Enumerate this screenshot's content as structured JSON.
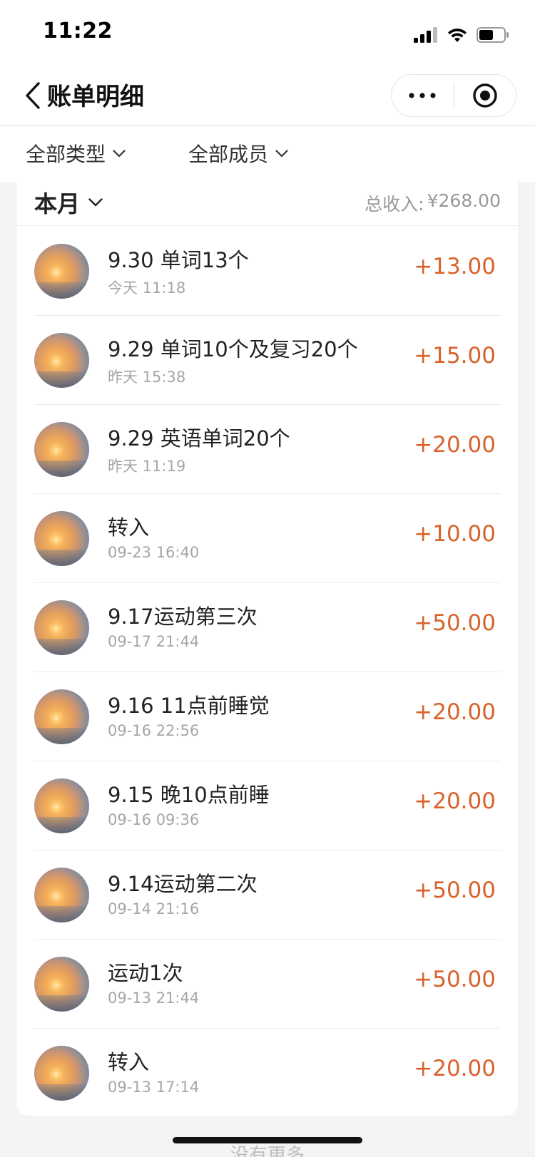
{
  "status_bar": {
    "time": "11:22"
  },
  "nav": {
    "title": "账单明细"
  },
  "filters": {
    "type_label": "全部类型",
    "member_label": "全部成员"
  },
  "summary": {
    "period": "本月",
    "total_label": "总收入:",
    "total_value": "¥268.00"
  },
  "transactions": [
    {
      "title": "9.30 单词13个",
      "time": "今天 11:18",
      "amount": "+13.00"
    },
    {
      "title": "9.29 单词10个及复习20个",
      "time": "昨天 15:38",
      "amount": "+15.00"
    },
    {
      "title": "9.29 英语单词20个",
      "time": "昨天 11:19",
      "amount": "+20.00"
    },
    {
      "title": "转入",
      "time": "09-23 16:40",
      "amount": "+10.00"
    },
    {
      "title": "9.17运动第三次",
      "time": "09-17 21:44",
      "amount": "+50.00"
    },
    {
      "title": "9.16 11点前睡觉",
      "time": "09-16 22:56",
      "amount": "+20.00"
    },
    {
      "title": "9.15 晚10点前睡",
      "time": "09-16 09:36",
      "amount": "+20.00"
    },
    {
      "title": "9.14运动第二次",
      "time": "09-14 21:16",
      "amount": "+50.00"
    },
    {
      "title": "运动1次",
      "time": "09-13 21:44",
      "amount": "+50.00"
    },
    {
      "title": "转入",
      "time": "09-13 17:14",
      "amount": "+20.00"
    }
  ],
  "footer": {
    "no_more": "没有更多"
  },
  "colors": {
    "amount": "#d9622b",
    "secondary_text": "#a6a6a6",
    "background": "#f4f4f4"
  },
  "icons": [
    "signal-icon",
    "wifi-icon",
    "battery-icon",
    "back-chevron-icon",
    "more-dots-icon",
    "target-close-icon",
    "chevron-down-icon",
    "avatar-sunset-image"
  ]
}
